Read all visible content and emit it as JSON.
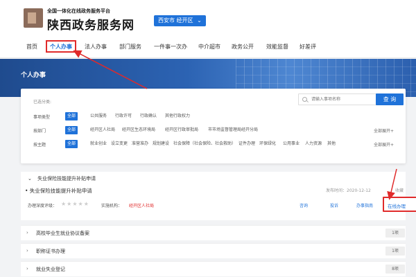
{
  "header": {
    "tagline": "全国一体化在线政务服务平台",
    "title": "陕西政务服务网",
    "region": "西安市 经开区",
    "region_icon": "chevron-down-icon"
  },
  "nav": {
    "items": [
      {
        "label": "首页"
      },
      {
        "label": "个人办事",
        "active": true
      },
      {
        "label": "法人办事"
      },
      {
        "label": "部门服务"
      },
      {
        "label": "一件事一次办"
      },
      {
        "label": "中介超市"
      },
      {
        "label": "政务公开"
      },
      {
        "label": "效能监督"
      },
      {
        "label": "好差评"
      }
    ]
  },
  "banner": {
    "title": "个人办事"
  },
  "filters": {
    "selected_label": "已选分类:",
    "search_placeholder": "请输入事项名称",
    "search_button": "查 询",
    "expand_label": "全部展开+",
    "all_label": "全部",
    "rows": [
      {
        "label": "事项类型",
        "options": [
          "公共服务",
          "行政许可",
          "行政确认",
          "其他行政权力"
        ]
      },
      {
        "label": "按部门",
        "options": [
          "经开区人社局",
          "经开区生态环境局",
          "经开区行政审批局",
          "市市场监督管理局经开分局"
        ]
      },
      {
        "label": "按主题",
        "options": [
          "就业创业",
          "设立变更",
          "准营准办",
          "规划建设",
          "社会保障（社会保险、社会救助）",
          "证件办理",
          "环保绿化",
          "公用事业",
          "人力资源",
          "其他"
        ]
      }
    ]
  },
  "list": {
    "open_group": {
      "name": "失业保险技能提升补贴申请",
      "item": {
        "title": "• 失业保险技能提升补贴申请",
        "date": "发布时间：2020-12-12",
        "favorite": "收藏",
        "rating_label": "办理深度评级：",
        "stars": "★★★★★",
        "org_label": "实施机构：",
        "org": "经开区人社局",
        "actions": [
          "咨询",
          "投诉",
          "办事指南"
        ],
        "online": "在线办理"
      }
    },
    "groups": [
      {
        "name": "高校毕业生就业协议备案",
        "count": "1项"
      },
      {
        "name": "职称证书办理",
        "count": "1项"
      },
      {
        "name": "就业失业登记",
        "count": "8项"
      }
    ]
  },
  "colors": {
    "accent": "#1f72d9",
    "highlight": "#e02a2a"
  }
}
